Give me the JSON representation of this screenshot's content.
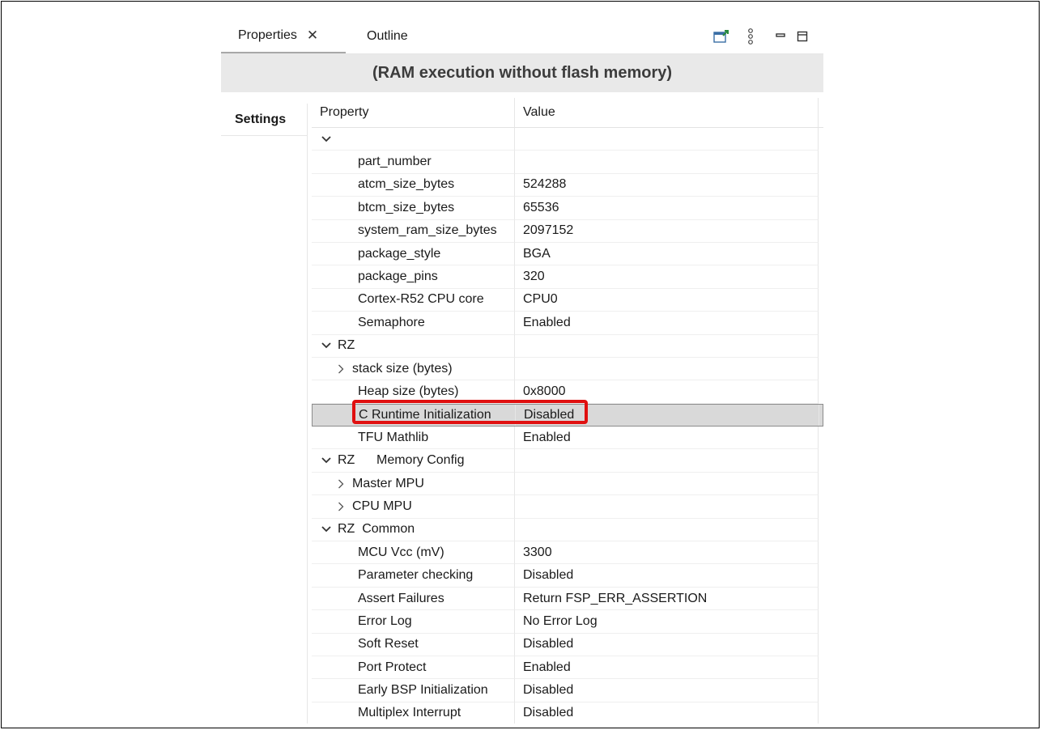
{
  "tabs": {
    "properties_label": "Properties",
    "outline_label": "Outline"
  },
  "header": {
    "title": "(RAM execution without flash memory)"
  },
  "side_tabs": [
    {
      "label": "Settings"
    }
  ],
  "table": {
    "columns": {
      "property": "Property",
      "value": "Value"
    },
    "rows": [
      {
        "property": "",
        "value": "",
        "indent": 0,
        "twisty": "expanded"
      },
      {
        "property": "part_number",
        "value": "",
        "indent": 2,
        "twisty": "none"
      },
      {
        "property": "atcm_size_bytes",
        "value": "524288",
        "indent": 2,
        "twisty": "none"
      },
      {
        "property": "btcm_size_bytes",
        "value": "65536",
        "indent": 2,
        "twisty": "none"
      },
      {
        "property": "system_ram_size_bytes",
        "value": "2097152",
        "indent": 2,
        "twisty": "none"
      },
      {
        "property": "package_style",
        "value": "BGA",
        "indent": 2,
        "twisty": "none"
      },
      {
        "property": "package_pins",
        "value": "320",
        "indent": 2,
        "twisty": "none"
      },
      {
        "property": "Cortex-R52 CPU core",
        "value": "CPU0",
        "indent": 2,
        "twisty": "none"
      },
      {
        "property": "Semaphore",
        "value": "Enabled",
        "indent": 2,
        "twisty": "none"
      },
      {
        "property": "RZ",
        "value": "",
        "indent": 0,
        "twisty": "expanded"
      },
      {
        "property": "stack size (bytes)",
        "value": "",
        "indent": 1,
        "twisty": "collapsed"
      },
      {
        "property": "Heap size (bytes)",
        "value": "0x8000",
        "indent": 2,
        "twisty": "none"
      },
      {
        "property": "C Runtime Initialization",
        "value": "Disabled",
        "indent": 2,
        "twisty": "none",
        "selected": true
      },
      {
        "property": "TFU Mathlib",
        "value": "Enabled",
        "indent": 2,
        "twisty": "none"
      },
      {
        "property": "RZ      Memory Config",
        "value": "",
        "indent": 0,
        "twisty": "expanded"
      },
      {
        "property": "Master MPU",
        "value": "",
        "indent": 1,
        "twisty": "collapsed"
      },
      {
        "property": "CPU MPU",
        "value": "",
        "indent": 1,
        "twisty": "collapsed"
      },
      {
        "property": "RZ  Common",
        "value": "",
        "indent": 0,
        "twisty": "expanded"
      },
      {
        "property": "MCU Vcc (mV)",
        "value": "3300",
        "indent": 2,
        "twisty": "none"
      },
      {
        "property": "Parameter checking",
        "value": "Disabled",
        "indent": 2,
        "twisty": "none"
      },
      {
        "property": "Assert Failures",
        "value": "Return FSP_ERR_ASSERTION",
        "indent": 2,
        "twisty": "none"
      },
      {
        "property": "Error Log",
        "value": "No Error Log",
        "indent": 2,
        "twisty": "none"
      },
      {
        "property": "Soft Reset",
        "value": "Disabled",
        "indent": 2,
        "twisty": "none"
      },
      {
        "property": "Port Protect",
        "value": "Enabled",
        "indent": 2,
        "twisty": "none"
      },
      {
        "property": "Early BSP Initialization",
        "value": "Disabled",
        "indent": 2,
        "twisty": "none"
      },
      {
        "property": "Multiplex Interrupt",
        "value": "Disabled",
        "indent": 2,
        "twisty": "none"
      }
    ]
  },
  "colors": {
    "header_bg": "#e9e9e9",
    "selected_row_bg": "#d9d9d9",
    "highlight": "#e01010",
    "toolbar_icon_accent": "#2a8a3e",
    "toolbar_icon_blue": "#3a6ea5"
  },
  "icons": {
    "close": "close-icon",
    "pin": "pin-editor-icon",
    "menu": "view-menu-icon",
    "minimize": "minimize-icon",
    "maximize": "maximize-icon"
  }
}
